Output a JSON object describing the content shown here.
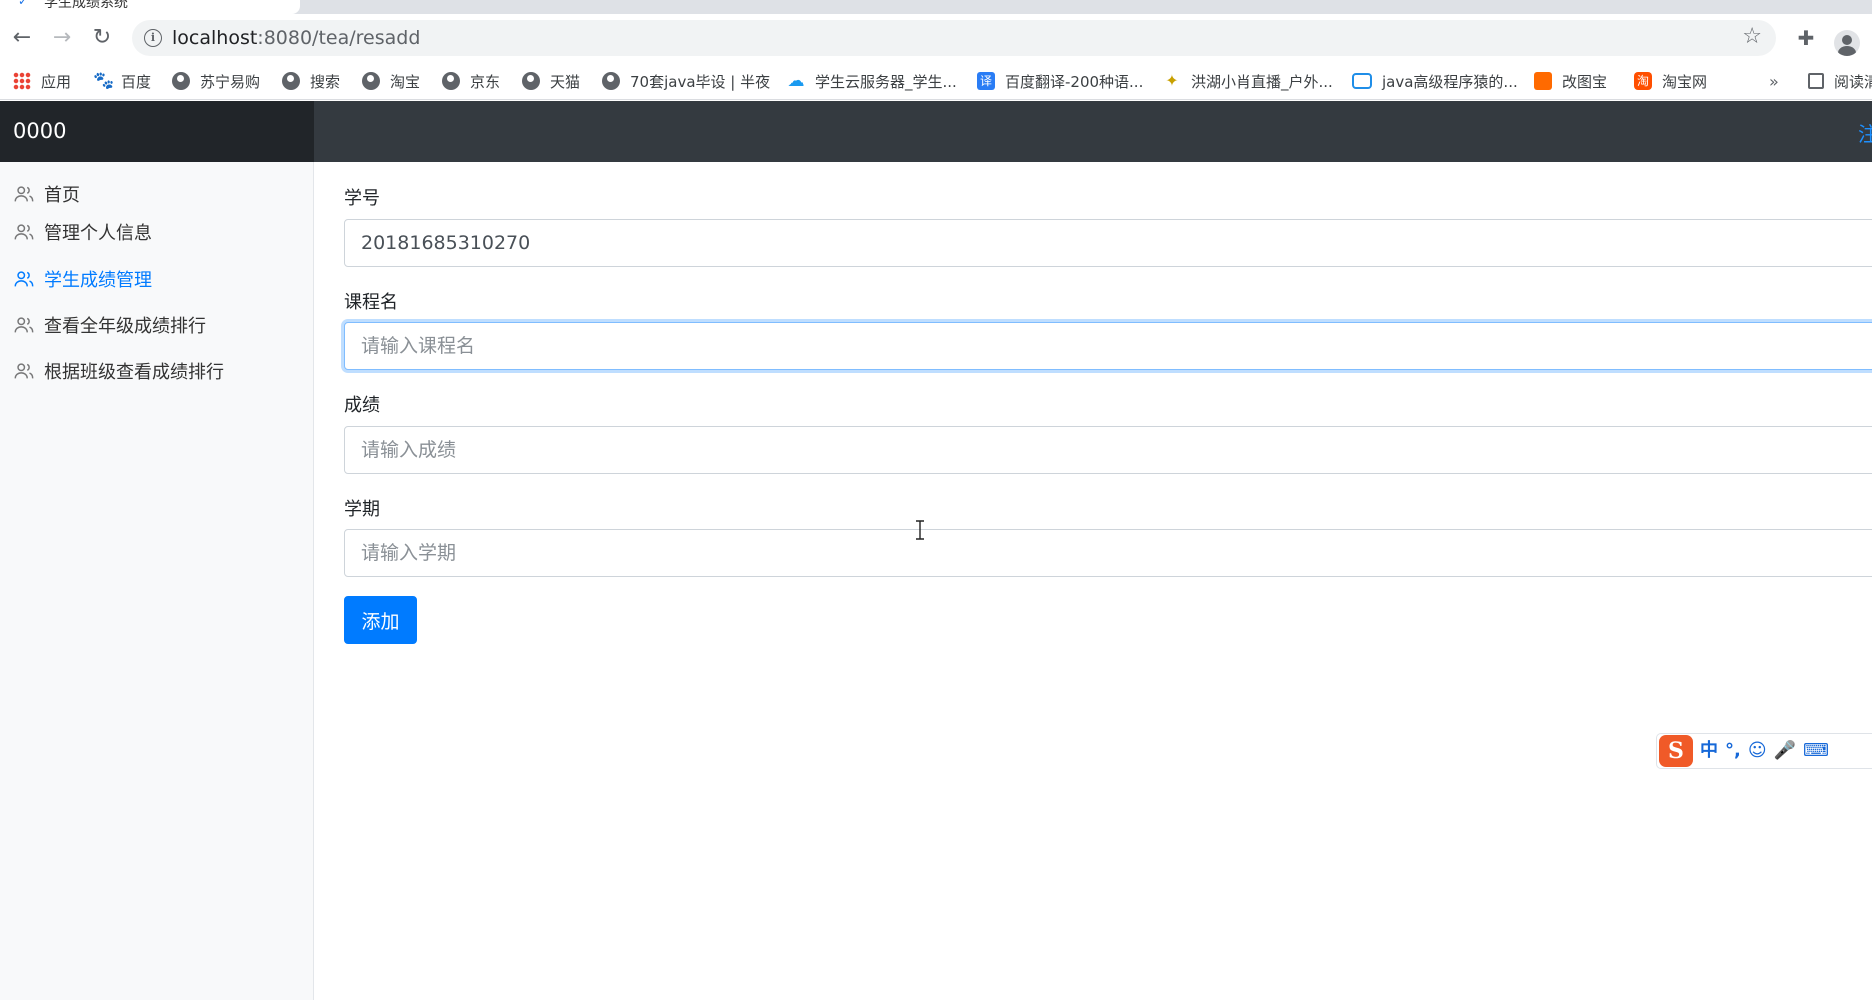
{
  "browser": {
    "tab_title": "学生成绩系统",
    "url_host": "localhost",
    "url_path": ":8080/tea/resadd",
    "bookmarks": [
      {
        "label": "应用",
        "icon": "apps-grid-icon"
      },
      {
        "label": "百度",
        "icon": "baidu-paw-icon"
      },
      {
        "label": "苏宁易购",
        "icon": "globe-icon"
      },
      {
        "label": "搜索",
        "icon": "globe-icon"
      },
      {
        "label": "淘宝",
        "icon": "globe-icon"
      },
      {
        "label": "京东",
        "icon": "globe-icon"
      },
      {
        "label": "天猫",
        "icon": "globe-icon"
      },
      {
        "label": "70套java毕设 | 半夜",
        "icon": "globe-icon"
      },
      {
        "label": "学生云服务器_学生...",
        "icon": "cloud-icon"
      },
      {
        "label": "百度翻译-200种语...",
        "icon": "translate-icon"
      },
      {
        "label": "洪湖小肖直播_户外...",
        "icon": "bee-icon"
      },
      {
        "label": "java高级程序猿的...",
        "icon": "bilibili-tv-icon"
      },
      {
        "label": "改图宝",
        "icon": "gaitubao-icon"
      },
      {
        "label": "淘宝网",
        "icon": "taobao-icon"
      }
    ],
    "bookmarks_more": "»",
    "reading_list": "阅读清单"
  },
  "app": {
    "brand": "0000",
    "signout": "注销"
  },
  "sidebar": {
    "items": [
      {
        "label": "首页",
        "active": false
      },
      {
        "label": "管理个人信息",
        "active": false
      },
      {
        "label": "学生成绩管理",
        "active": true
      },
      {
        "label": "查看全年级成绩排行",
        "active": false
      },
      {
        "label": "根据班级查看成绩排行",
        "active": false
      }
    ]
  },
  "form": {
    "student_id": {
      "label": "学号",
      "value": "20181685310270"
    },
    "course": {
      "label": "课程名",
      "placeholder": "请输入课程名"
    },
    "score": {
      "label": "成绩",
      "placeholder": "请输入成绩"
    },
    "term": {
      "label": "学期",
      "placeholder": "请输入学期"
    },
    "submit_label": "添加"
  },
  "ime": {
    "items": [
      "中",
      "°,",
      "☺",
      "🎤",
      "⌨"
    ]
  },
  "colors": {
    "primary": "#007bff",
    "topbar": "#343a40",
    "brand_bg": "#212529",
    "sidebar_bg": "#f8f9fa"
  }
}
